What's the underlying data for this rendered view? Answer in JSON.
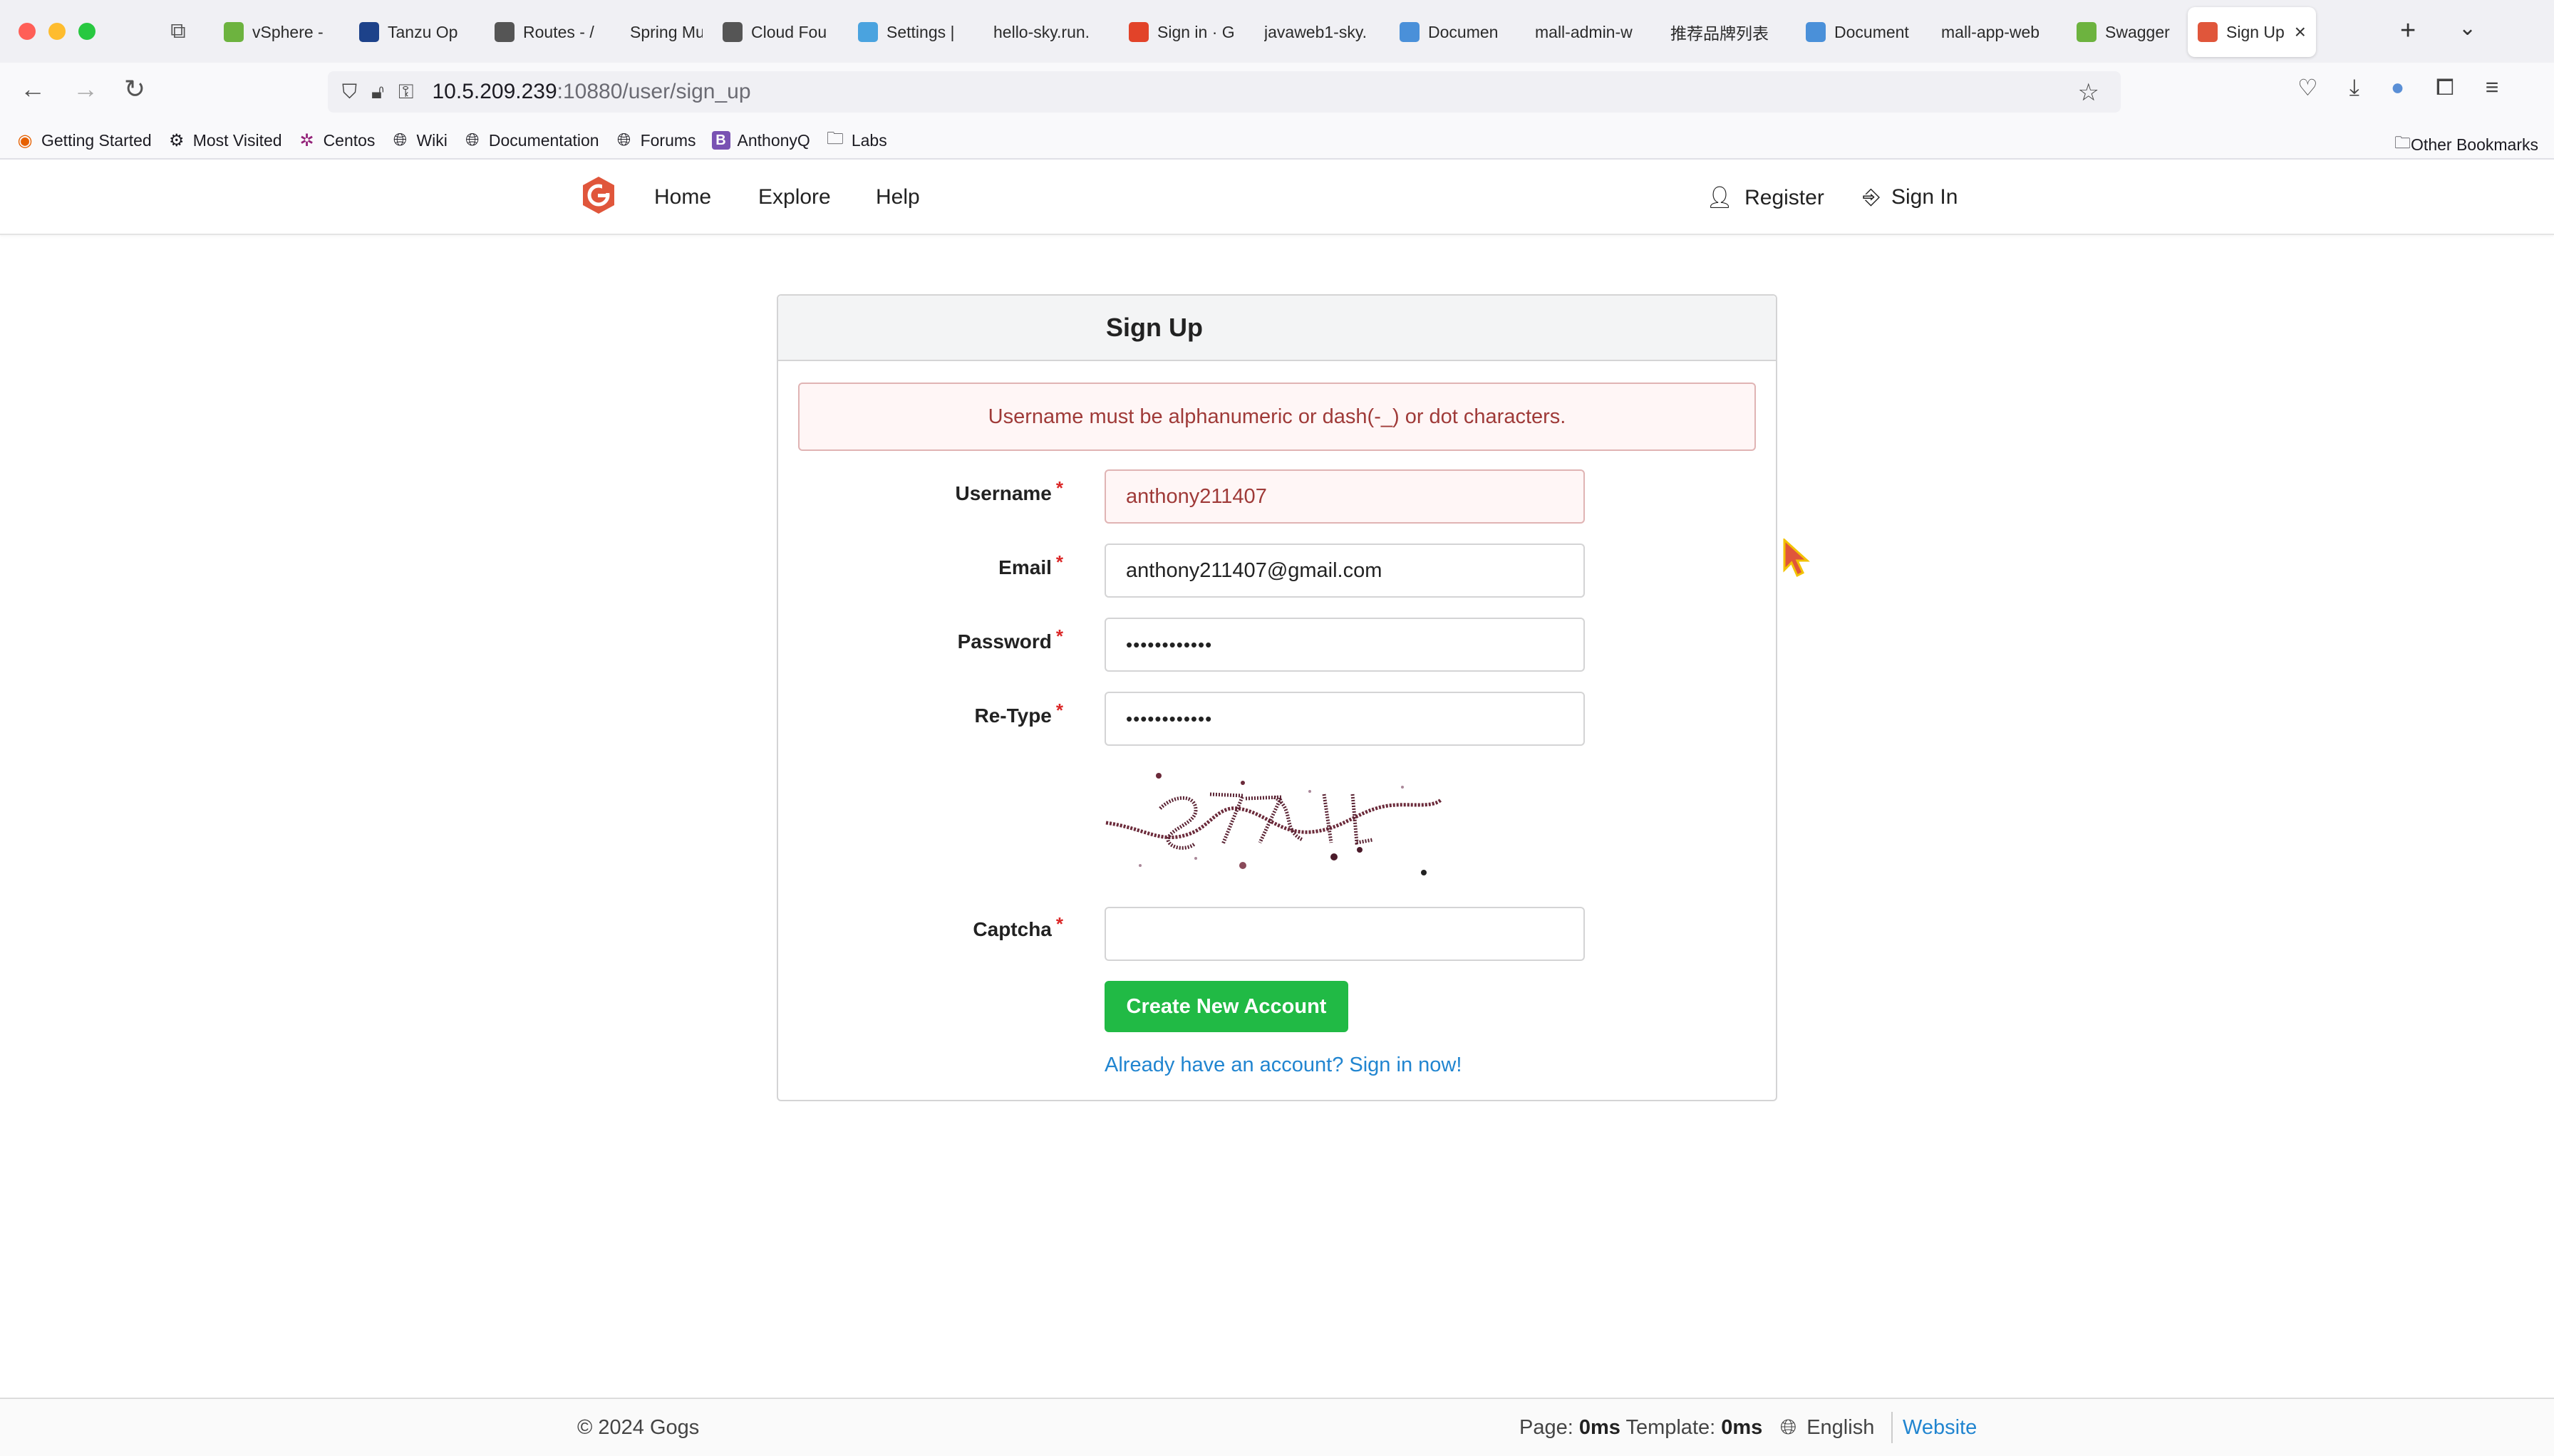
{
  "browser": {
    "tabs": [
      {
        "title": "vSphere -",
        "icon_color": "#6db33f"
      },
      {
        "title": "Tanzu Op",
        "icon_color": "#1d428a"
      },
      {
        "title": "Routes - /",
        "icon_color": "#555555"
      },
      {
        "title": "Spring Music",
        "icon_color": ""
      },
      {
        "title": "Cloud Fou",
        "icon_color": "#555555"
      },
      {
        "title": "Settings |",
        "icon_color": "#4aa3df"
      },
      {
        "title": "hello-sky.run.",
        "icon_color": ""
      },
      {
        "title": "Sign in · G",
        "icon_color": "#e24329"
      },
      {
        "title": "javaweb1-sky.",
        "icon_color": ""
      },
      {
        "title": "Documen",
        "icon_color": "#4a90d9"
      },
      {
        "title": "mall-admin-w",
        "icon_color": ""
      },
      {
        "title": "推荐品牌列表",
        "icon_color": ""
      },
      {
        "title": "Document",
        "icon_color": "#4a90d9"
      },
      {
        "title": "mall-app-web",
        "icon_color": ""
      },
      {
        "title": "Swagger",
        "icon_color": "#6db33f"
      },
      {
        "title": "Sign Up",
        "icon_color": "#e0563b",
        "active": true
      }
    ],
    "url": {
      "host": "10.5.209.239",
      "path": ":10880/user/sign_up"
    },
    "bookmarks": [
      {
        "label": "Getting Started",
        "icon": "firefox-icon"
      },
      {
        "label": "Most Visited",
        "icon": "gear-icon"
      },
      {
        "label": "Centos",
        "icon": "centos-icon"
      },
      {
        "label": "Wiki",
        "icon": "globe-icon"
      },
      {
        "label": "Documentation",
        "icon": "globe-icon"
      },
      {
        "label": "Forums",
        "icon": "globe-icon"
      },
      {
        "label": "AnthonyQ",
        "icon": "bootstrap-icon"
      },
      {
        "label": "Labs",
        "icon": "folder-icon"
      }
    ],
    "other_bookmarks": "Other Bookmarks"
  },
  "header": {
    "nav": [
      "Home",
      "Explore",
      "Help"
    ],
    "register": "Register",
    "signin": "Sign In"
  },
  "signup": {
    "title": "Sign Up",
    "error": "Username must be alphanumeric or dash(-_) or dot characters.",
    "fields": {
      "username": {
        "label": "Username",
        "value": "anthony211407"
      },
      "email": {
        "label": "Email",
        "value": "anthony211407@gmail.com"
      },
      "password": {
        "label": "Password",
        "value": "••••••••••••"
      },
      "retype": {
        "label": "Re-Type",
        "value": "••••••••••••"
      },
      "captcha": {
        "label": "Captcha",
        "value": ""
      }
    },
    "required_mark": "*",
    "submit": "Create New Account",
    "signin_link": "Already have an account? Sign in now!"
  },
  "footer": {
    "copyright": "© 2024 Gogs",
    "page_label": "Page:",
    "page_time": "0ms",
    "template_label": "Template:",
    "template_time": "0ms",
    "language": "English",
    "website": "Website"
  },
  "colors": {
    "error_text": "#9f3a38",
    "error_bg": "#fff6f6",
    "primary_green": "#21ba45",
    "link_blue": "#2185d0",
    "gogs_orange": "#e0563b"
  }
}
